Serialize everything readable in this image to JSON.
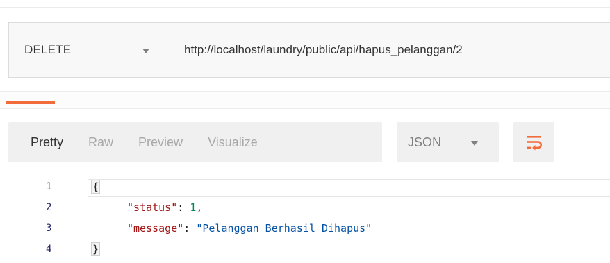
{
  "request": {
    "method": "DELETE",
    "url": "http://localhost/laundry/public/api/hapus_pelanggan/2"
  },
  "response": {
    "view_tabs": [
      "Pretty",
      "Raw",
      "Preview",
      "Visualize"
    ],
    "active_view_tab": "Pretty",
    "format": "JSON",
    "line_numbers": [
      "1",
      "2",
      "3",
      "4"
    ],
    "code": {
      "open_brace": "{",
      "close_brace": "}",
      "status_key": "\"status\"",
      "status_value": "1",
      "message_key": "\"message\"",
      "message_value": "\"Pelanggan Berhasil Dihapus\"",
      "colon": ": ",
      "comma": ","
    }
  },
  "icons": {
    "method_dropdown": "chevron-down-icon",
    "format_dropdown": "chevron-down-icon",
    "wrap": "text-wrap-icon"
  },
  "colors": {
    "accent": "#f26b3a",
    "json_key": "#a31515",
    "json_number": "#098658",
    "json_string": "#0451a5"
  }
}
